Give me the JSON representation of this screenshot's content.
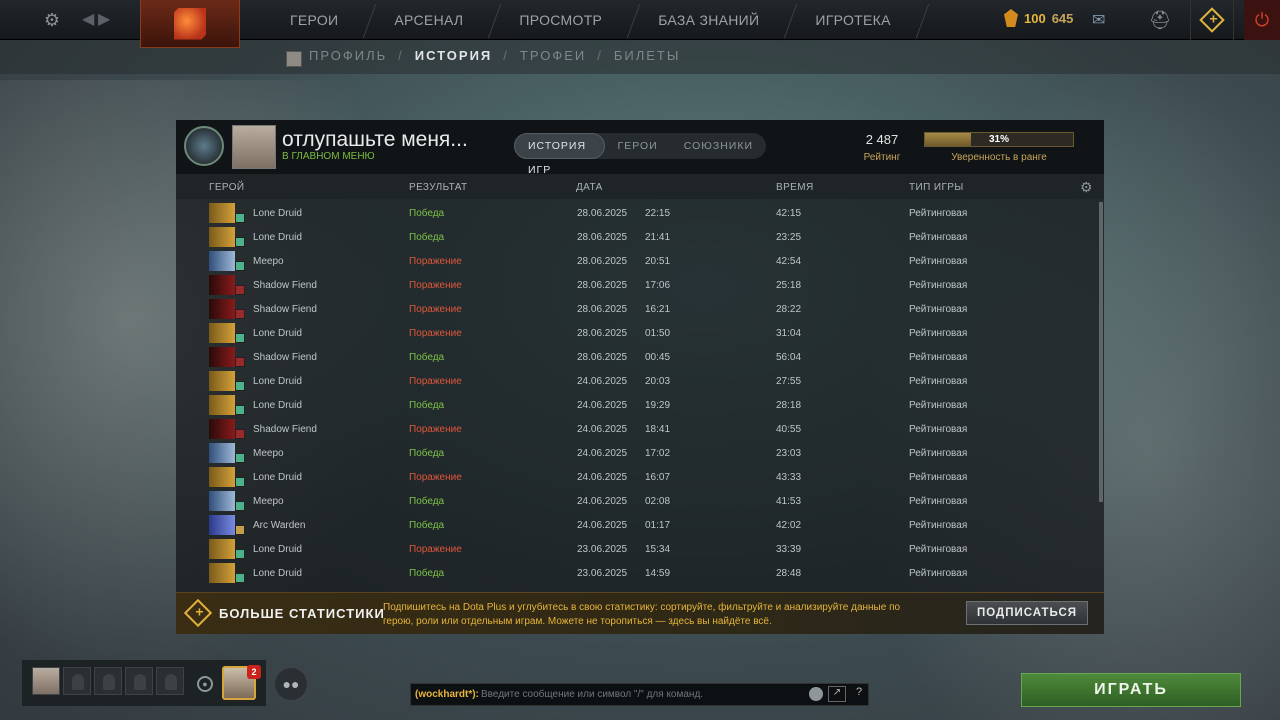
{
  "topbar": {
    "nav": [
      "ГЕРОИ",
      "АРСЕНАЛ",
      "ПРОСМОТР",
      "БАЗА ЗНАНИЙ",
      "ИГРОТЕКА"
    ],
    "currency_a": "100",
    "currency_b": "645",
    "icons": {
      "settings": "gear-icon",
      "back": "arrow-left-icon",
      "forward": "arrow-right-icon",
      "chat": "chat-icon",
      "armory": "armory-icon",
      "dota_plus": "dota-plus-icon",
      "power": "power-icon"
    }
  },
  "subnav": {
    "items": [
      "ПРОФИЛЬ",
      "ИСТОРИЯ",
      "ТРОФЕИ",
      "БИЛЕТЫ"
    ],
    "active": "ИСТОРИЯ"
  },
  "profile": {
    "name": "отлупашьте меня...",
    "status": "В ГЛАВНОМ МЕНЮ",
    "tabs": [
      "ИСТОРИЯ ИГР",
      "ГЕРОИ",
      "СОЮЗНИКИ"
    ],
    "rating_value": "2 487",
    "rating_label": "Рейтинг",
    "confidence_value": "31%",
    "confidence_fraction": 0.31,
    "confidence_label": "Уверенность в ранге"
  },
  "table": {
    "headers": {
      "hero": "ГЕРОЙ",
      "result": "РЕЗУЛЬТАТ",
      "date": "ДАТА",
      "time": "ВРЕМЯ",
      "type": "ТИП ИГРЫ"
    },
    "rows": [
      {
        "hero": "Lone Druid",
        "result": "Победа",
        "win": true,
        "date": "28.06.2025",
        "time": "22:15",
        "duration": "42:15",
        "type": "Рейтинговая"
      },
      {
        "hero": "Lone Druid",
        "result": "Победа",
        "win": true,
        "date": "28.06.2025",
        "time": "21:41",
        "duration": "23:25",
        "type": "Рейтинговая"
      },
      {
        "hero": "Meepo",
        "result": "Поражение",
        "win": false,
        "date": "28.06.2025",
        "time": "20:51",
        "duration": "42:54",
        "type": "Рейтинговая"
      },
      {
        "hero": "Shadow Fiend",
        "result": "Поражение",
        "win": false,
        "date": "28.06.2025",
        "time": "17:06",
        "duration": "25:18",
        "type": "Рейтинговая"
      },
      {
        "hero": "Shadow Fiend",
        "result": "Поражение",
        "win": false,
        "date": "28.06.2025",
        "time": "16:21",
        "duration": "28:22",
        "type": "Рейтинговая"
      },
      {
        "hero": "Lone Druid",
        "result": "Поражение",
        "win": false,
        "date": "28.06.2025",
        "time": "01:50",
        "duration": "31:04",
        "type": "Рейтинговая"
      },
      {
        "hero": "Shadow Fiend",
        "result": "Победа",
        "win": true,
        "date": "28.06.2025",
        "time": "00:45",
        "duration": "56:04",
        "type": "Рейтинговая"
      },
      {
        "hero": "Lone Druid",
        "result": "Поражение",
        "win": false,
        "date": "24.06.2025",
        "time": "20:03",
        "duration": "27:55",
        "type": "Рейтинговая"
      },
      {
        "hero": "Lone Druid",
        "result": "Победа",
        "win": true,
        "date": "24.06.2025",
        "time": "19:29",
        "duration": "28:18",
        "type": "Рейтинговая"
      },
      {
        "hero": "Shadow Fiend",
        "result": "Поражение",
        "win": false,
        "date": "24.06.2025",
        "time": "18:41",
        "duration": "40:55",
        "type": "Рейтинговая"
      },
      {
        "hero": "Meepo",
        "result": "Победа",
        "win": true,
        "date": "24.06.2025",
        "time": "17:02",
        "duration": "23:03",
        "type": "Рейтинговая"
      },
      {
        "hero": "Lone Druid",
        "result": "Поражение",
        "win": false,
        "date": "24.06.2025",
        "time": "16:07",
        "duration": "43:33",
        "type": "Рейтинговая"
      },
      {
        "hero": "Meepo",
        "result": "Победа",
        "win": true,
        "date": "24.06.2025",
        "time": "02:08",
        "duration": "41:53",
        "type": "Рейтинговая"
      },
      {
        "hero": "Arc Warden",
        "result": "Победа",
        "win": true,
        "date": "24.06.2025",
        "time": "01:17",
        "duration": "42:02",
        "type": "Рейтинговая"
      },
      {
        "hero": "Lone Druid",
        "result": "Поражение",
        "win": false,
        "date": "23.06.2025",
        "time": "15:34",
        "duration": "33:39",
        "type": "Рейтинговая"
      },
      {
        "hero": "Lone Druid",
        "result": "Победа",
        "win": true,
        "date": "23.06.2025",
        "time": "14:59",
        "duration": "28:48",
        "type": "Рейтинговая"
      }
    ]
  },
  "banner": {
    "title": "БОЛЬШЕ СТАТИСТИКИ",
    "text": "Подпишитесь на Dota Plus и углубитесь в свою статистику: сортируйте, фильтруйте и анализируйте данные по герою, роли или отдельным играм. Можете не торопиться — здесь вы найдёте всё.",
    "button": "ПОДПИСАТЬСЯ"
  },
  "bottom": {
    "notifications": "2",
    "chat_user": "(wockhardt*):",
    "chat_placeholder": "Введите сообщение или символ \"/\" для команд.",
    "help": "?",
    "play": "ИГРАТЬ"
  },
  "colors": {
    "win": "#7fc24a",
    "loss": "#e0563a",
    "accent": "#e6b53a"
  }
}
